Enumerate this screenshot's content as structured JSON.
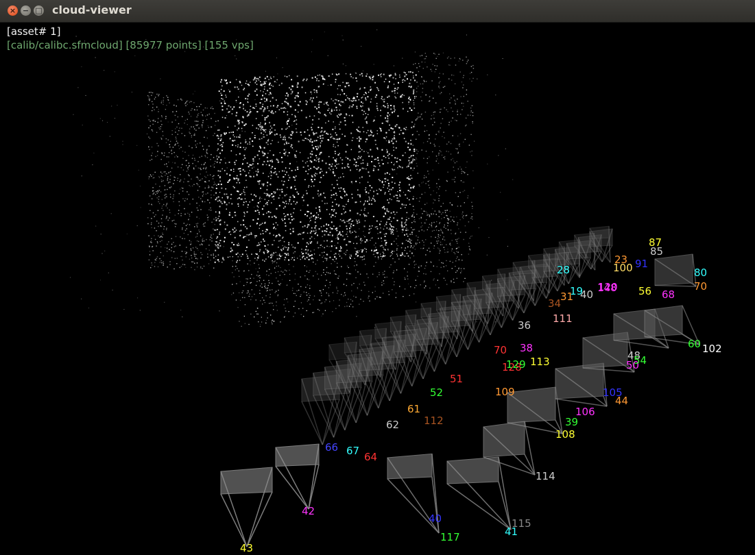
{
  "window": {
    "title": "cloud-viewer"
  },
  "overlay": {
    "asset_line": "[asset# 1]",
    "info_line": "[calib/calibc.sfmcloud] [85977 points] [155 vps]"
  },
  "colors": {
    "background": "#000000",
    "points": "#ffffff",
    "info_text": "#6fa86f",
    "camera_gray": "#8a8a8a"
  },
  "camera_labels": [
    {
      "text": "43",
      "color": "#ffff33"
    },
    {
      "text": "42",
      "color": "#ff33ff"
    },
    {
      "text": "117",
      "color": "#33ff33"
    },
    {
      "text": "40",
      "color": "#3333ff"
    },
    {
      "text": "41",
      "color": "#33ffff"
    },
    {
      "text": "115",
      "color": "#888888"
    },
    {
      "text": "114",
      "color": "#cccccc"
    },
    {
      "text": "66",
      "color": "#4444ff"
    },
    {
      "text": "67",
      "color": "#33ffff"
    },
    {
      "text": "64",
      "color": "#ff3333"
    },
    {
      "text": "62",
      "color": "#cccccc"
    },
    {
      "text": "112",
      "color": "#aa5522"
    },
    {
      "text": "61",
      "color": "#ffaa33"
    },
    {
      "text": "52",
      "color": "#33ff33"
    },
    {
      "text": "109",
      "color": "#ff9933"
    },
    {
      "text": "108",
      "color": "#ffff33"
    },
    {
      "text": "39",
      "color": "#33ff33"
    },
    {
      "text": "106",
      "color": "#ff33ff"
    },
    {
      "text": "105",
      "color": "#3333ff"
    },
    {
      "text": "44",
      "color": "#ff9933"
    },
    {
      "text": "128",
      "color": "#ff3333"
    },
    {
      "text": "113",
      "color": "#ffff33"
    },
    {
      "text": "129",
      "color": "#33ff33"
    },
    {
      "text": "38",
      "color": "#ff33ff"
    },
    {
      "text": "36",
      "color": "#cccccc"
    },
    {
      "text": "70",
      "color": "#ff3333"
    },
    {
      "text": "51",
      "color": "#ff3333"
    },
    {
      "text": "111",
      "color": "#ffaaaa"
    },
    {
      "text": "34",
      "color": "#aa5522"
    },
    {
      "text": "31",
      "color": "#ff9933"
    },
    {
      "text": "40",
      "color": "#cccccc"
    },
    {
      "text": "19",
      "color": "#33ffff"
    },
    {
      "text": "120",
      "color": "#ff33ff"
    },
    {
      "text": "148",
      "color": "#ff33ff"
    },
    {
      "text": "56",
      "color": "#ffff33"
    },
    {
      "text": "68",
      "color": "#ff33ff"
    },
    {
      "text": "80",
      "color": "#33ffff"
    },
    {
      "text": "70",
      "color": "#ff9933"
    },
    {
      "text": "100",
      "color": "#ffdd66"
    },
    {
      "text": "91",
      "color": "#3333ff"
    },
    {
      "text": "28",
      "color": "#33ffff"
    },
    {
      "text": "87",
      "color": "#ffff33"
    },
    {
      "text": "85",
      "color": "#cccccc"
    },
    {
      "text": "48",
      "color": "#cccccc"
    },
    {
      "text": "50",
      "color": "#ff33ff"
    },
    {
      "text": "54",
      "color": "#33ff33"
    },
    {
      "text": "60",
      "color": "#33ff33"
    },
    {
      "text": "102",
      "color": "#ffffff"
    },
    {
      "text": "23",
      "color": "#ff9933"
    }
  ]
}
